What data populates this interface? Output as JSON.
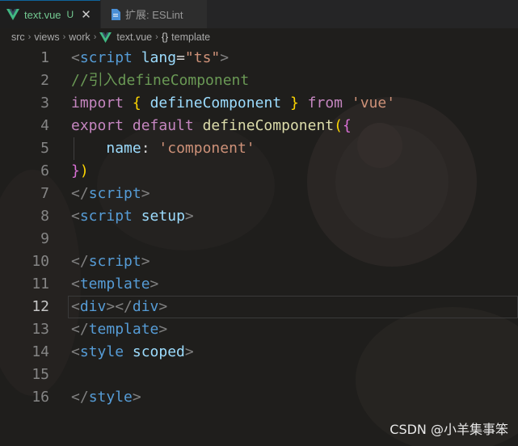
{
  "tabs": {
    "active": {
      "label": "text.vue",
      "status": "U",
      "close": "✕"
    },
    "inactive": {
      "label": "扩展: ESLint"
    }
  },
  "breadcrumb": {
    "items": [
      "src",
      "views",
      "work",
      "text.vue",
      "template"
    ],
    "separator": "›",
    "braces": "{}"
  },
  "editor": {
    "current_line": 12,
    "lines": [
      {
        "n": "1",
        "tokens": [
          [
            "t-punc",
            "<"
          ],
          [
            "t-tag",
            "script"
          ],
          [
            "t-plain",
            " "
          ],
          [
            "t-attr",
            "lang"
          ],
          [
            "t-plain",
            "="
          ],
          [
            "t-str",
            "\"ts\""
          ],
          [
            "t-punc",
            ">"
          ]
        ]
      },
      {
        "n": "2",
        "tokens": [
          [
            "t-com",
            "//引入defineComponent"
          ]
        ]
      },
      {
        "n": "3",
        "tokens": [
          [
            "t-kw",
            "import"
          ],
          [
            "t-plain",
            " "
          ],
          [
            "t-brace1",
            "{"
          ],
          [
            "t-plain",
            " "
          ],
          [
            "t-id",
            "defineComponent"
          ],
          [
            "t-plain",
            " "
          ],
          [
            "t-brace1",
            "}"
          ],
          [
            "t-plain",
            " "
          ],
          [
            "t-kw",
            "from"
          ],
          [
            "t-plain",
            " "
          ],
          [
            "t-str",
            "'vue'"
          ]
        ]
      },
      {
        "n": "4",
        "tokens": [
          [
            "t-kw",
            "export"
          ],
          [
            "t-plain",
            " "
          ],
          [
            "t-kw",
            "default"
          ],
          [
            "t-plain",
            " "
          ],
          [
            "t-fn",
            "defineComponent"
          ],
          [
            "t-brace1",
            "("
          ],
          [
            "t-brace2",
            "{"
          ]
        ]
      },
      {
        "n": "5",
        "tokens": [
          [
            "t-plain",
            "    "
          ],
          [
            "t-id",
            "name"
          ],
          [
            "t-plain",
            ": "
          ],
          [
            "t-str",
            "'component'"
          ]
        ]
      },
      {
        "n": "6",
        "tokens": [
          [
            "t-brace2",
            "}"
          ],
          [
            "t-brace1",
            ")"
          ]
        ]
      },
      {
        "n": "7",
        "tokens": [
          [
            "t-punc",
            "</"
          ],
          [
            "t-tag",
            "script"
          ],
          [
            "t-punc",
            ">"
          ]
        ]
      },
      {
        "n": "8",
        "tokens": [
          [
            "t-punc",
            "<"
          ],
          [
            "t-tag",
            "script"
          ],
          [
            "t-plain",
            " "
          ],
          [
            "t-attr",
            "setup"
          ],
          [
            "t-punc",
            ">"
          ]
        ]
      },
      {
        "n": "9",
        "tokens": []
      },
      {
        "n": "10",
        "tokens": [
          [
            "t-punc",
            "</"
          ],
          [
            "t-tag",
            "script"
          ],
          [
            "t-punc",
            ">"
          ]
        ]
      },
      {
        "n": "11",
        "tokens": [
          [
            "t-punc",
            "<"
          ],
          [
            "t-tag",
            "template"
          ],
          [
            "t-punc",
            ">"
          ]
        ]
      },
      {
        "n": "12",
        "tokens": [
          [
            "t-punc",
            "<"
          ],
          [
            "t-tag",
            "div"
          ],
          [
            "t-punc",
            "></"
          ],
          [
            "t-tag",
            "div"
          ],
          [
            "t-punc",
            ">"
          ]
        ]
      },
      {
        "n": "13",
        "tokens": [
          [
            "t-punc",
            "</"
          ],
          [
            "t-tag",
            "template"
          ],
          [
            "t-punc",
            ">"
          ]
        ]
      },
      {
        "n": "14",
        "tokens": [
          [
            "t-punc",
            "<"
          ],
          [
            "t-tag",
            "style"
          ],
          [
            "t-plain",
            " "
          ],
          [
            "t-attr",
            "scoped"
          ],
          [
            "t-punc",
            ">"
          ]
        ]
      },
      {
        "n": "15",
        "tokens": []
      },
      {
        "n": "16",
        "tokens": [
          [
            "t-punc",
            "</"
          ],
          [
            "t-tag",
            "style"
          ],
          [
            "t-punc",
            ">"
          ]
        ]
      }
    ]
  },
  "watermark": "CSDN @小羊集事笨",
  "colors": {
    "accent": "#0e639c",
    "vue_green": "#41b883",
    "modified": "#73c991"
  }
}
